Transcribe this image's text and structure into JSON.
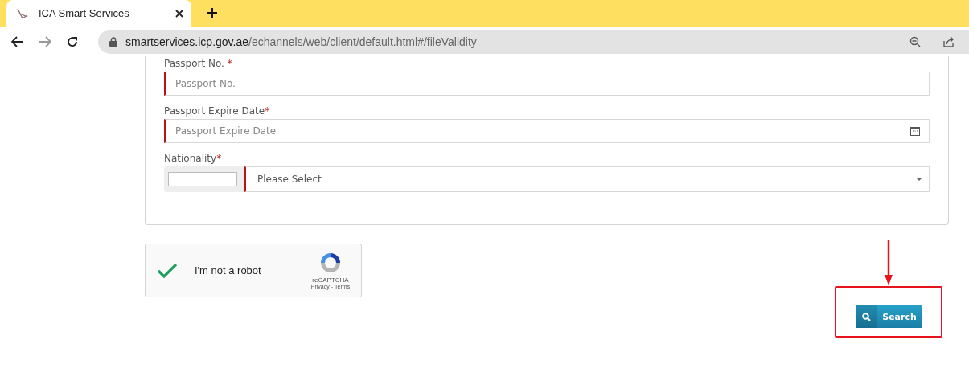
{
  "browser": {
    "tab": {
      "title": "ICA Smart Services",
      "selected": true
    },
    "address": {
      "host": "smartservices.icp.gov.ae",
      "path": "/echannels/web/client/default.html#/fileValidity"
    }
  },
  "form": {
    "fields": [
      {
        "kind": "text",
        "label": "Passport No. ",
        "required_mark": "*",
        "placeholder": "Passport No.",
        "invalid": true
      },
      {
        "kind": "date",
        "label": "Passport Expire Date",
        "required_mark": "*",
        "placeholder": "Passport Expire Date",
        "invalid": true
      },
      {
        "kind": "select",
        "label": "Nationality",
        "required_mark": "*",
        "value": "Please Select",
        "invalid": true
      }
    ]
  },
  "captcha": {
    "checked": true,
    "label": "I'm not a robot",
    "brand": "reCAPTCHA",
    "links": [
      "Privacy",
      "Terms"
    ],
    "separator": "-"
  },
  "search_button": {
    "label": "Search",
    "highlighted": true
  }
}
